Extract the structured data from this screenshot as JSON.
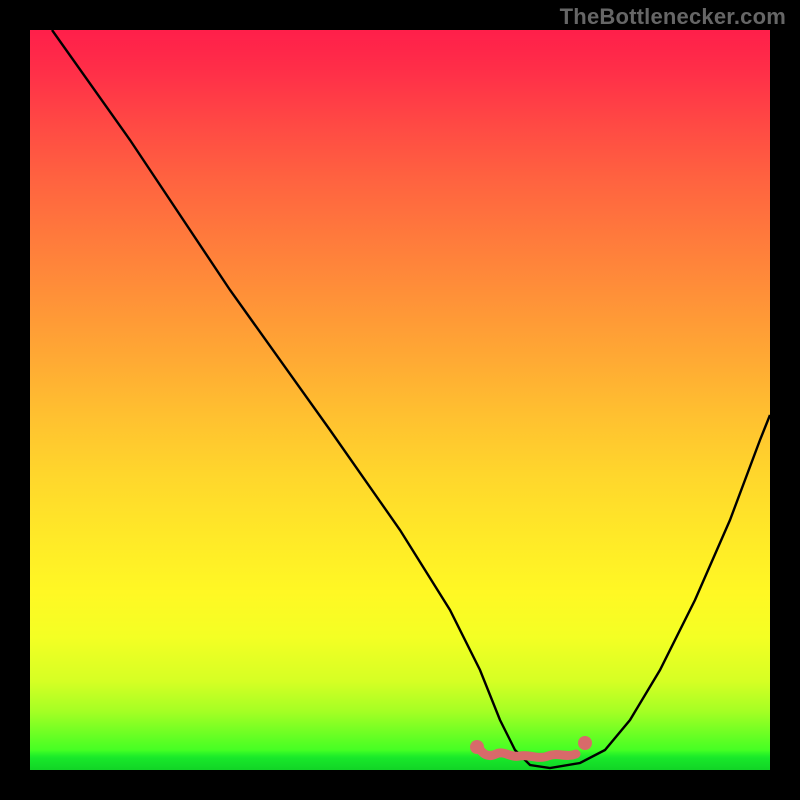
{
  "watermark": "TheBottlenecker.com",
  "chart_data": {
    "type": "line",
    "title": "",
    "xlabel": "",
    "ylabel": "",
    "xlim": [
      0,
      100
    ],
    "ylim": [
      0,
      100
    ],
    "series": [
      {
        "name": "curve",
        "x": [
          3,
          10,
          20,
          30,
          40,
          50,
          55,
          58,
          60,
          63,
          67,
          72,
          76,
          80,
          85,
          90,
          95,
          99
        ],
        "y": [
          100,
          88,
          72,
          56,
          40,
          25,
          16,
          10,
          6,
          3,
          1,
          1,
          2,
          5,
          12,
          24,
          40,
          55
        ]
      }
    ],
    "minimum_band": {
      "x_start": 58,
      "x_end": 76,
      "y": 1
    },
    "gradient_stops": [
      {
        "pos": 0,
        "color": "#ff1f4a"
      },
      {
        "pos": 50,
        "color": "#ffd62c"
      },
      {
        "pos": 100,
        "color": "#18ff24"
      }
    ]
  }
}
